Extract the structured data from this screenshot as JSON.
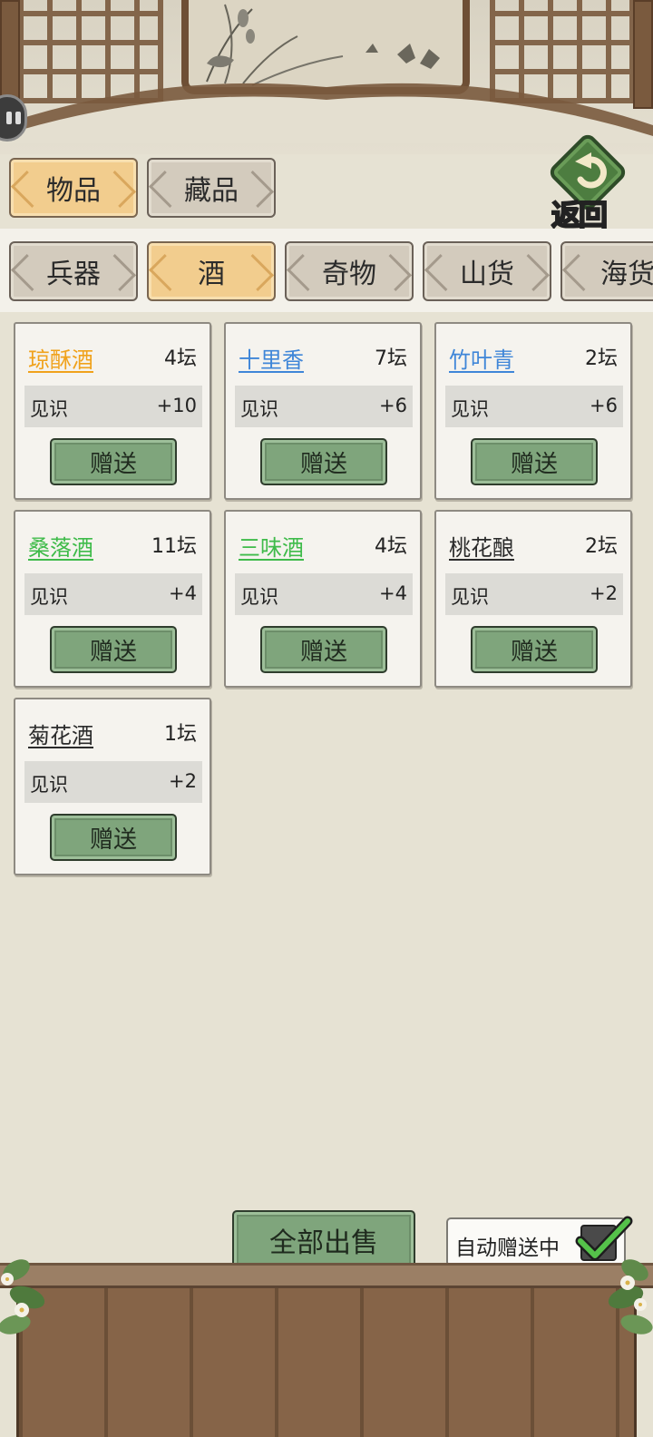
{
  "top_tabs": [
    {
      "label": "物品",
      "active": true
    },
    {
      "label": "藏品",
      "active": false
    }
  ],
  "back_button": {
    "label": "返回",
    "icon": "return-arrow-icon"
  },
  "category_tabs": [
    {
      "label": "兵器",
      "active": false
    },
    {
      "label": "酒",
      "active": true
    },
    {
      "label": "奇物",
      "active": false
    },
    {
      "label": "山货",
      "active": false
    },
    {
      "label": "海货",
      "active": false
    }
  ],
  "items": [
    {
      "name": "琼酥酒",
      "name_color": "#f0a21c",
      "qty": "4坛",
      "stat_label": "见识",
      "stat_value": "+10",
      "button": "赠送"
    },
    {
      "name": "十里香",
      "name_color": "#3f86d8",
      "qty": "7坛",
      "stat_label": "见识",
      "stat_value": "+6",
      "button": "赠送"
    },
    {
      "name": "竹叶青",
      "name_color": "#3f86d8",
      "qty": "2坛",
      "stat_label": "见识",
      "stat_value": "+6",
      "button": "赠送"
    },
    {
      "name": "桑落酒",
      "name_color": "#3fbb4a",
      "qty": "11坛",
      "stat_label": "见识",
      "stat_value": "+4",
      "button": "赠送"
    },
    {
      "name": "三味酒",
      "name_color": "#3fbb4a",
      "qty": "4坛",
      "stat_label": "见识",
      "stat_value": "+4",
      "button": "赠送"
    },
    {
      "name": "桃花酿",
      "name_color": "#2b2b2b",
      "qty": "2坛",
      "stat_label": "见识",
      "stat_value": "+2",
      "button": "赠送"
    },
    {
      "name": "菊花酒",
      "name_color": "#2b2b2b",
      "qty": "1坛",
      "stat_label": "见识",
      "stat_value": "+2",
      "button": "赠送"
    }
  ],
  "footer": {
    "sell_all": "全部出售",
    "auto_gift_label": "自动赠送中",
    "auto_gift_checked": true
  },
  "colors": {
    "background": "#e6e2d3",
    "active_tab": "#f2cd8e",
    "inactive_tab": "#d3cbbd",
    "green_button": "#7fa57c",
    "wood": "#7a5a3e"
  }
}
